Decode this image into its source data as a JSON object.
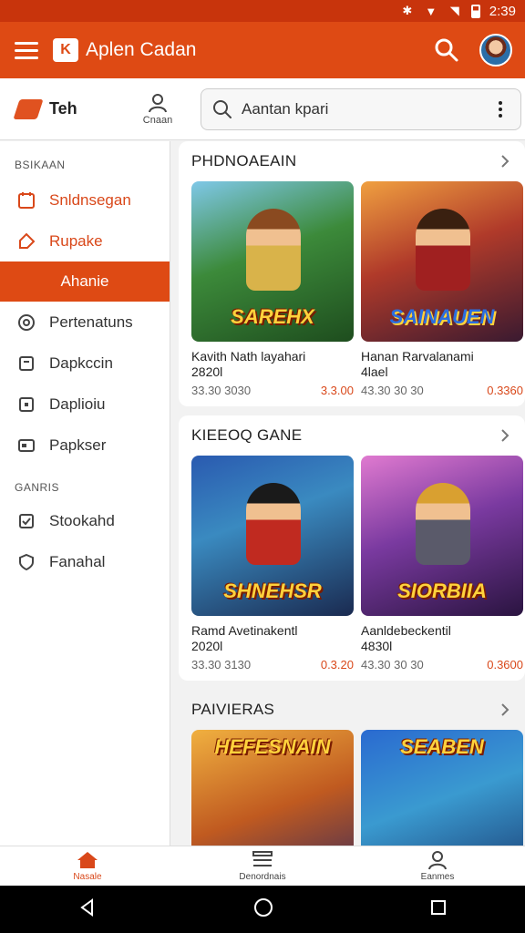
{
  "status_bar": {
    "time": "2:39"
  },
  "app_bar": {
    "title": "Aplen Cadan",
    "logo_text": "K"
  },
  "top_row": {
    "brand_label": "Teh",
    "account_label": "Cnaan",
    "search_value": "Aantan kpari"
  },
  "sidebar": {
    "section1_label": "BSIKAAN",
    "items1": [
      {
        "label": "Snldnsegan",
        "icon": "calendar-icon"
      },
      {
        "label": "Rupake",
        "icon": "tag-icon"
      },
      {
        "label": "Ahanie",
        "icon": "none"
      },
      {
        "label": "Pertenatuns",
        "icon": "gamepad-icon"
      },
      {
        "label": "Dapkccin",
        "icon": "box-icon"
      },
      {
        "label": "Daplioiu",
        "icon": "square-icon"
      },
      {
        "label": "Papkser",
        "icon": "card-icon"
      }
    ],
    "section2_label": "GANRIS",
    "items2": [
      {
        "label": "Stookahd",
        "icon": "checkbox-icon"
      },
      {
        "label": "Fanahal",
        "icon": "shield-icon"
      }
    ]
  },
  "sections": [
    {
      "title": "PHDNOAEAIN",
      "items": [
        {
          "name": "Kavith Nath layahari\n2820l",
          "meta": "33.30 3030",
          "price": "3.3.00",
          "logo": "SAREHX"
        },
        {
          "name": "Hanan Rarvalanami\n4lael",
          "meta": "43.30 30 30",
          "price": "0.3360",
          "logo": "SAINAUEN"
        }
      ]
    },
    {
      "title": "KIEEOQ GANE",
      "items": [
        {
          "name": "Ramd Avetinakentl\n2020l",
          "meta": "33.30 3130",
          "price": "0.3.20",
          "logo": "SHNEHSR"
        },
        {
          "name": "Aanldebeckentil\n4830l",
          "meta": "43.30 30 30",
          "price": "0.3600",
          "logo": "SIORBIIA"
        }
      ]
    },
    {
      "title": "PAIVIERAS",
      "items": [
        {
          "name": "",
          "meta": "",
          "price": "",
          "logo": "HEFESNAIN"
        },
        {
          "name": "",
          "meta": "",
          "price": "",
          "logo": "SEABEN"
        }
      ]
    }
  ],
  "bottom_nav": [
    {
      "label": "Nasale",
      "icon": "home-icon"
    },
    {
      "label": "Denordnais",
      "icon": "list-icon"
    },
    {
      "label": "Eanmes",
      "icon": "user-icon"
    }
  ],
  "colors": {
    "accent": "#de4a14",
    "status": "#c8340c"
  }
}
